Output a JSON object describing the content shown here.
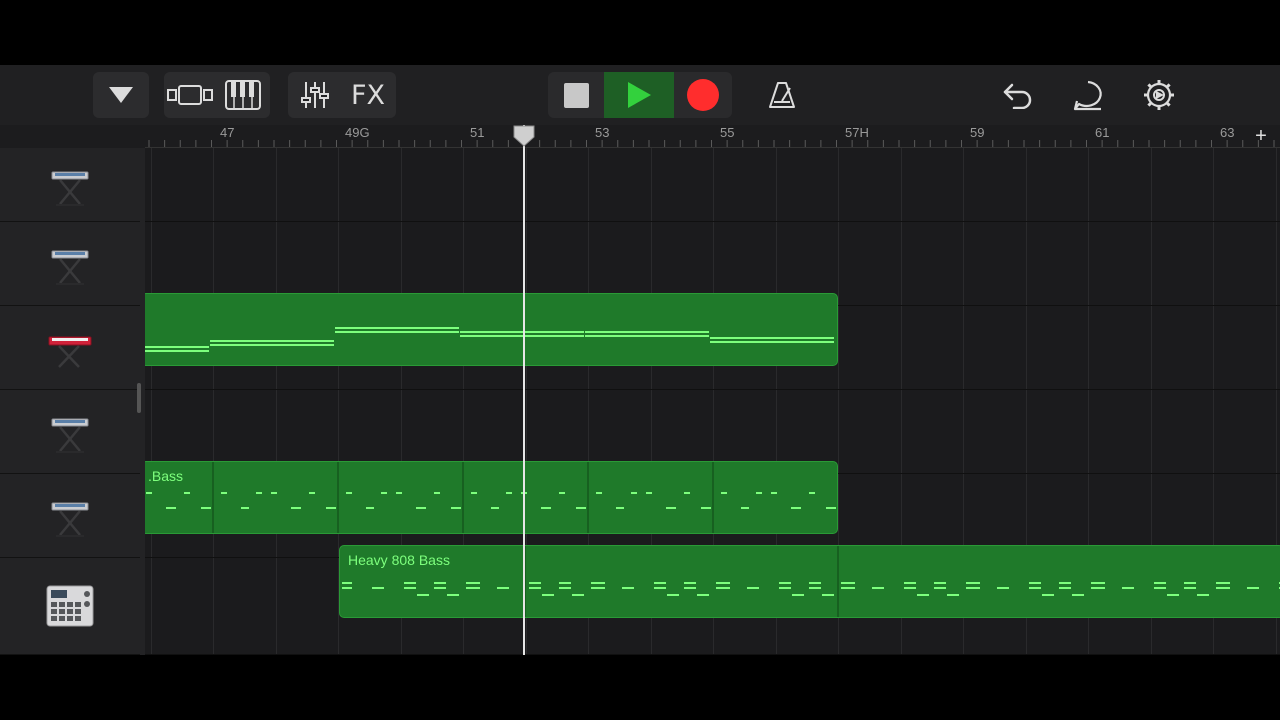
{
  "toolbar": {
    "fx_label": "FX",
    "icons": [
      "browser-dropdown-icon",
      "tracks-view-icon",
      "keyboard-icon",
      "mixer-icon",
      "fx-icon",
      "stop-icon",
      "play-icon",
      "record-icon",
      "metronome-icon",
      "undo-icon",
      "loop-icon",
      "settings-icon"
    ]
  },
  "ruler": {
    "bars": [
      {
        "label": "47"
      },
      {
        "label": "49G"
      },
      {
        "label": "51"
      },
      {
        "label": "53"
      },
      {
        "label": "55"
      },
      {
        "label": "57H"
      },
      {
        "label": "59"
      },
      {
        "label": "61"
      },
      {
        "label": "63"
      }
    ],
    "add_label": "+"
  },
  "tracks": [
    {
      "instrument": "keyboard-stand-icon"
    },
    {
      "instrument": "keyboard-stand-icon"
    },
    {
      "instrument": "red-keyboard-icon"
    },
    {
      "instrument": "keyboard-stand-icon"
    },
    {
      "instrument": "keyboard-stand-icon"
    },
    {
      "instrument": "drum-machine-icon"
    }
  ],
  "regions": {
    "bass_name": ".Bass",
    "heavy_808_name": "Heavy 808 Bass"
  },
  "colors": {
    "region_fill": "#1f7a2a",
    "note": "#7dff7d",
    "record": "#ff2d2d",
    "play": "#33d13d"
  }
}
